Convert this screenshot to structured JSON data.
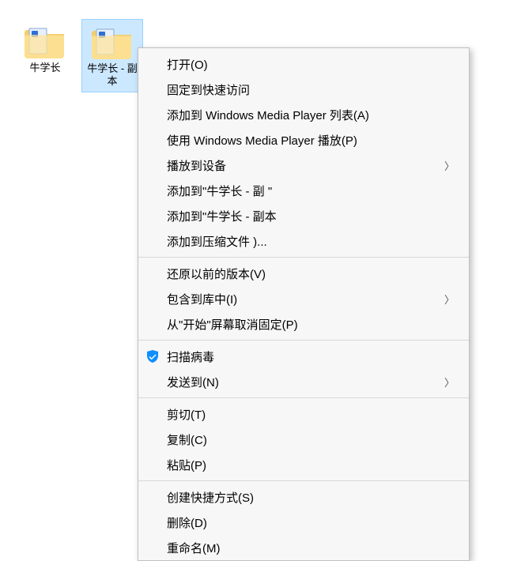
{
  "icons": [
    {
      "label": "牛学长",
      "selected": false
    },
    {
      "label": "牛学长 - 副本",
      "selected": true
    }
  ],
  "menu": {
    "group1": [
      {
        "id": "open",
        "label": "打开(O)",
        "submenu": false,
        "icon": null
      },
      {
        "id": "pin-quick",
        "label": "固定到快速访问",
        "submenu": false,
        "icon": null
      },
      {
        "id": "wmp-add",
        "label": "添加到 Windows Media Player 列表(A)",
        "submenu": false,
        "icon": null
      },
      {
        "id": "wmp-play",
        "label": "使用 Windows Media Player 播放(P)",
        "submenu": false,
        "icon": null
      },
      {
        "id": "cast",
        "label": "播放到设备",
        "submenu": true,
        "icon": null
      },
      {
        "id": "archive-add-1",
        "label": "添加到\"牛学长 - 副    \"",
        "submenu": false,
        "icon": null
      },
      {
        "id": "archive-add-2",
        "label": "添加到\"牛学长 - 副本",
        "submenu": false,
        "icon": null
      },
      {
        "id": "archive-add-3",
        "label": "添加到压缩文件              )...",
        "submenu": false,
        "icon": null
      }
    ],
    "group2": [
      {
        "id": "restore-prev",
        "label": "还原以前的版本(V)",
        "submenu": false,
        "icon": null
      },
      {
        "id": "include-lib",
        "label": "包含到库中(I)",
        "submenu": true,
        "icon": null
      },
      {
        "id": "unpin-start",
        "label": "从\"开始\"屏幕取消固定(P)",
        "submenu": false,
        "icon": null
      }
    ],
    "group3": [
      {
        "id": "scan-virus",
        "label": "扫描病毒",
        "submenu": false,
        "icon": "shield"
      },
      {
        "id": "send-to",
        "label": "发送到(N)",
        "submenu": true,
        "icon": null
      }
    ],
    "group4": [
      {
        "id": "cut",
        "label": "剪切(T)",
        "submenu": false,
        "icon": null
      },
      {
        "id": "copy",
        "label": "复制(C)",
        "submenu": false,
        "icon": null
      },
      {
        "id": "paste",
        "label": "粘贴(P)",
        "submenu": false,
        "icon": null
      }
    ],
    "group5": [
      {
        "id": "shortcut",
        "label": "创建快捷方式(S)",
        "submenu": false,
        "icon": null
      },
      {
        "id": "delete",
        "label": "删除(D)",
        "submenu": false,
        "icon": null
      },
      {
        "id": "rename",
        "label": "重命名(M)",
        "submenu": false,
        "icon": null
      }
    ]
  },
  "glyph": {
    "chevron_right": "〉"
  }
}
